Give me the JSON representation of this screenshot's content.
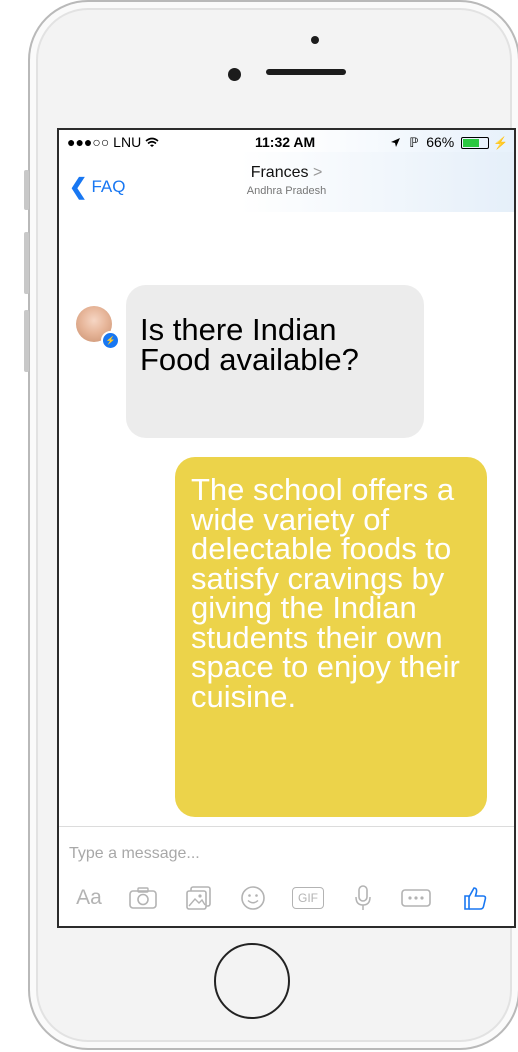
{
  "status_bar": {
    "carrier": "●●●○○ LNU",
    "time": "11:32 AM",
    "battery": "66%"
  },
  "nav": {
    "back_label": "FAQ",
    "contact_name": "Frances",
    "contact_arrow": ">",
    "contact_location": "Andhra Pradesh"
  },
  "messages": [
    {
      "direction": "incoming",
      "text": "Is there Indian Food available?"
    },
    {
      "direction": "outgoing",
      "text": "The school offers a wide variety of delectable foods to satisfy cravings by giving the Indian students their own space to enjoy their cuisine."
    }
  ],
  "composer": {
    "placeholder": "Type a message...",
    "aa_label": "Aa",
    "gif_label": "GIF",
    "icons": [
      "camera-icon",
      "photo-icon",
      "emoji-icon",
      "gif-icon",
      "microphone-icon",
      "more-icon",
      "like-icon"
    ]
  },
  "colors": {
    "accent": "#1877f2",
    "outgoing_bubble": "#ecd34a",
    "incoming_bubble": "#ececec"
  }
}
